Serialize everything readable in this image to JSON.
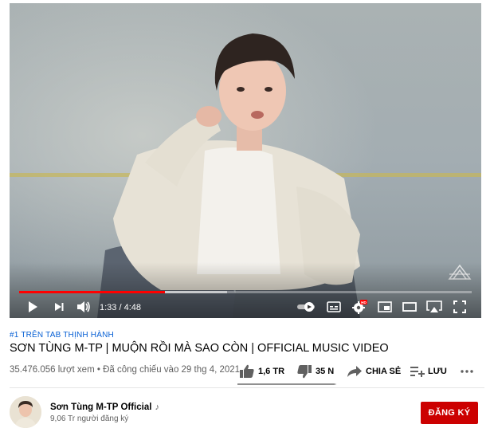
{
  "player": {
    "time_display": "1:33 / 4:48",
    "progress_played_fraction": 0.323,
    "progress_loaded_fraction": 0.46,
    "quality_badge": "HD",
    "accent_color": "#ff0000"
  },
  "video": {
    "hashtag": "#1 TRÊN TAB THỊNH HÀNH",
    "title": "SƠN TÙNG M-TP | MUỘN RỒI MÀ SAO CÒN | OFFICIAL MUSIC VIDEO",
    "meta": "35.476.056 lượt xem • Đã công chiếu vào 29 thg 4, 2021"
  },
  "actions": {
    "like_count": "1,6 TR",
    "dislike_count": "35 N",
    "share_label": "CHIA SẺ",
    "save_label": "LƯU",
    "like_ratio": 0.98
  },
  "channel": {
    "name": "Sơn Tùng M-TP Official",
    "music_note": "♪",
    "subscribers": "9,06 Tr người đăng ký",
    "subscribe_label": "ĐĂNG KÝ",
    "subscribe_color": "#cc0000"
  }
}
